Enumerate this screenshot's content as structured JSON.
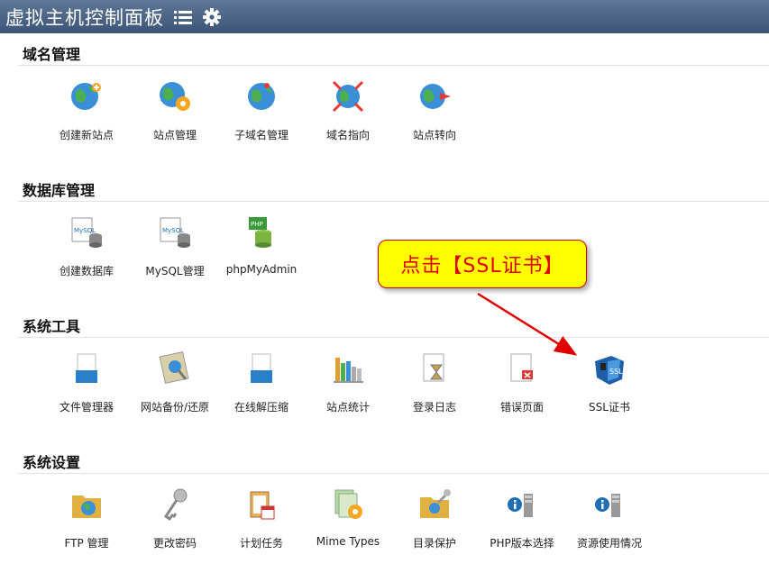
{
  "header": {
    "title": "虚拟主机控制面板",
    "menu_icon": "list-icon",
    "settings_icon": "gear-icon"
  },
  "sections": [
    {
      "title": "域名管理",
      "items": [
        {
          "label": "创建新站点",
          "icon": "globe-plus-icon"
        },
        {
          "label": "站点管理",
          "icon": "globe-gear-icon"
        },
        {
          "label": "子域名管理",
          "icon": "globe-sub-icon"
        },
        {
          "label": "域名指向",
          "icon": "globe-pointer-icon"
        },
        {
          "label": "站点转向",
          "icon": "globe-redirect-icon"
        }
      ]
    },
    {
      "title": "数据库管理",
      "items": [
        {
          "label": "创建数据库",
          "icon": "mysql-db-icon"
        },
        {
          "label": "MySQL管理",
          "icon": "mysql-manage-icon"
        },
        {
          "label": "phpMyAdmin",
          "icon": "php-db-icon"
        }
      ]
    },
    {
      "title": "系统工具",
      "items": [
        {
          "label": "文件管理器",
          "icon": "file-manager-icon"
        },
        {
          "label": "网站备份/还原",
          "icon": "backup-icon"
        },
        {
          "label": "在线解压缩",
          "icon": "unzip-icon"
        },
        {
          "label": "站点统计",
          "icon": "bar-chart-icon"
        },
        {
          "label": "登录日志",
          "icon": "log-hourglass-icon"
        },
        {
          "label": "错误页面",
          "icon": "error-page-icon"
        },
        {
          "label": "SSL证书",
          "icon": "ssl-certificate-icon"
        }
      ]
    },
    {
      "title": "系统设置",
      "items": [
        {
          "label": "FTP 管理",
          "icon": "ftp-folder-icon"
        },
        {
          "label": "更改密码",
          "icon": "key-icon"
        },
        {
          "label": "计划任务",
          "icon": "calendar-clipboard-icon"
        },
        {
          "label": "Mime Types",
          "icon": "mime-gear-icon"
        },
        {
          "label": "目录保护",
          "icon": "folder-key-icon"
        },
        {
          "label": "PHP版本选择",
          "icon": "info-server-icon"
        },
        {
          "label": "资源使用情况",
          "icon": "info-server-icon"
        }
      ]
    }
  ],
  "annotation": {
    "text": "点击【SSL证书】",
    "color": "#e00000",
    "background": "#ffff00"
  },
  "colors": {
    "header_bg": "#4a6283",
    "callout_bg": "#ffff00",
    "arrow": "#e00000"
  }
}
